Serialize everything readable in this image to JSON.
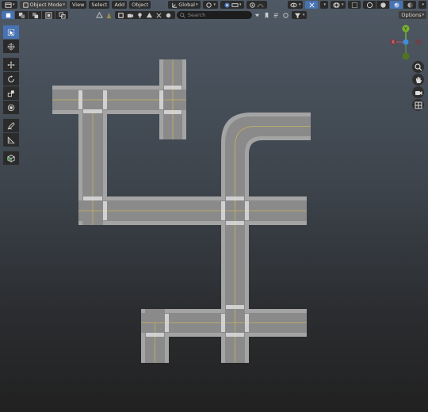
{
  "header": {
    "mode": "Object Mode",
    "menus": [
      "View",
      "Select",
      "Add",
      "Object"
    ],
    "transform_orientation": "Global",
    "options_label": "Options",
    "search_placeholder": "Search"
  },
  "gizmo": {
    "x_label": "X",
    "y_label": "Y",
    "z_label": "Z"
  },
  "colors": {
    "accent": "#4772b3",
    "road": "#808080",
    "sidewalk": "#a6a6a6",
    "lane_line": "#c5b45f",
    "axis_x": "#e05a63",
    "axis_y": "#7ab32a",
    "axis_z": "#3f8fe0"
  },
  "icons": {
    "toolbar": [
      "select-box-icon",
      "cursor-icon",
      "move-icon",
      "rotate-icon",
      "scale-icon",
      "transform-icon",
      "annotate-icon",
      "measure-icon",
      "add-cube-icon"
    ],
    "navigation": [
      "zoom-icon",
      "pan-hand-icon",
      "camera-icon",
      "perspective-grid-icon"
    ]
  }
}
